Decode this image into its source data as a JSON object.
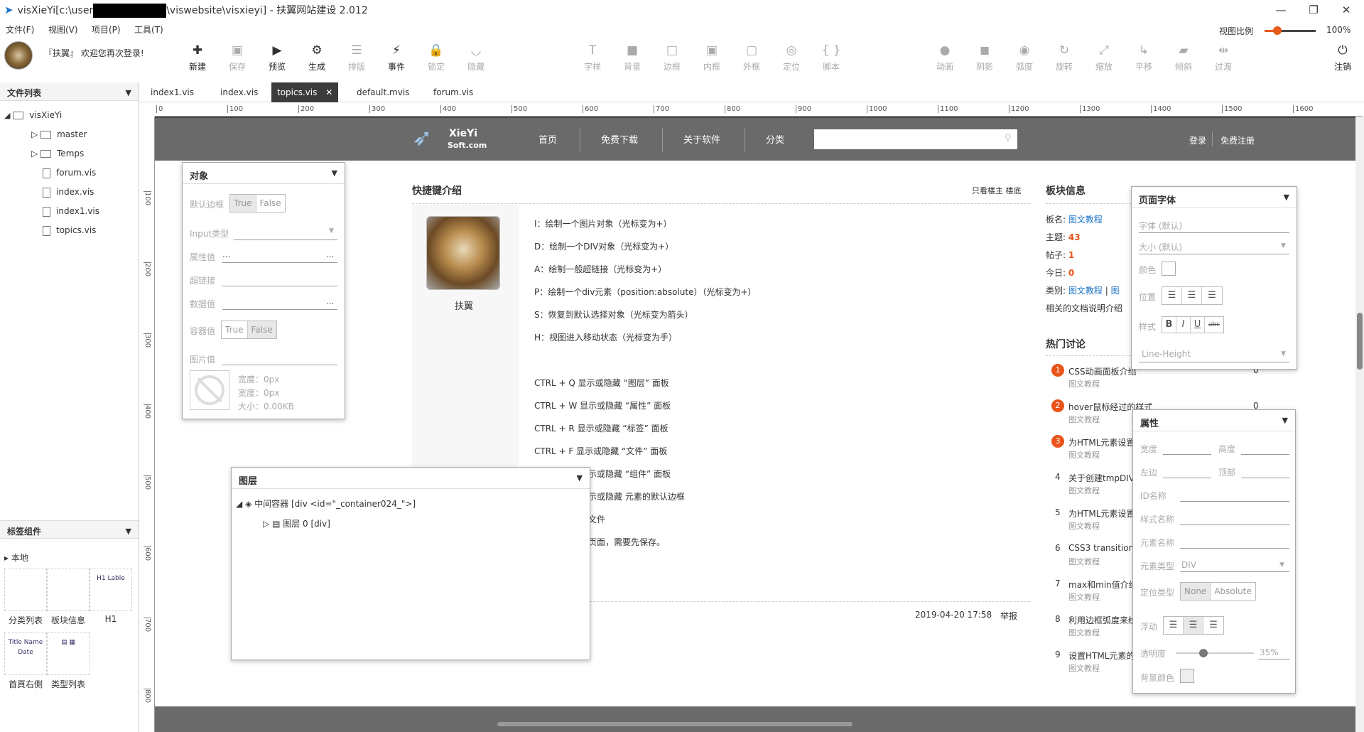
{
  "window": {
    "title_prefix": "visXieYi[c:\\user",
    "title_suffix": "\\viswebsite\\visxieyi] - 扶翼网站建设 2.012",
    "minimize": "—",
    "maximize": "❐",
    "close": "✕"
  },
  "menu": [
    "文件(F)",
    "视图(V)",
    "项目(P)",
    "工具(T)"
  ],
  "user": {
    "welcome": "『扶翼』 欢迎您再次登录!"
  },
  "toolbar": {
    "groups": [
      {
        "label": "新建",
        "glyph": "✚",
        "enabled": true
      },
      {
        "label": "保存",
        "glyph": "▣",
        "enabled": false
      },
      {
        "label": "预览",
        "glyph": "▶",
        "enabled": true
      },
      {
        "label": "生成",
        "glyph": "⚙",
        "enabled": true
      },
      {
        "label": "排版",
        "glyph": "☰",
        "enabled": false
      },
      {
        "label": "事件",
        "glyph": "⚡",
        "enabled": true
      },
      {
        "label": "锁定",
        "glyph": "🔒",
        "enabled": false
      },
      {
        "label": "隐藏",
        "glyph": "◡",
        "enabled": false
      },
      {
        "label": "字样",
        "glyph": "T",
        "enabled": false
      },
      {
        "label": "背景",
        "glyph": "■",
        "enabled": false
      },
      {
        "label": "边框",
        "glyph": "□",
        "enabled": false
      },
      {
        "label": "内框",
        "glyph": "▣",
        "enabled": false
      },
      {
        "label": "外框",
        "glyph": "▢",
        "enabled": false
      },
      {
        "label": "定位",
        "glyph": "◎",
        "enabled": false
      },
      {
        "label": "脚本",
        "glyph": "{ }",
        "enabled": false
      },
      {
        "label": "动画",
        "glyph": "●",
        "enabled": false
      },
      {
        "label": "阴影",
        "glyph": "◼",
        "enabled": false
      },
      {
        "label": "弧度",
        "glyph": "◉",
        "enabled": false
      },
      {
        "label": "旋转",
        "glyph": "↻",
        "enabled": false
      },
      {
        "label": "缩放",
        "glyph": "⤢",
        "enabled": false
      },
      {
        "label": "平移",
        "glyph": "↳",
        "enabled": false
      },
      {
        "label": "倾斜",
        "glyph": "▰",
        "enabled": false
      },
      {
        "label": "过渡",
        "glyph": "⇹",
        "enabled": false
      },
      {
        "label": "注销",
        "glyph": "⏻",
        "enabled": true
      }
    ]
  },
  "zoom": {
    "label": "视图比例",
    "value": "100%",
    "fraction": 0.25
  },
  "filelist": {
    "title": "文件列表",
    "root": "visXieYi",
    "folders": [
      "master",
      "Temps"
    ],
    "files": [
      "forum.vis",
      "index.vis",
      "index1.vis",
      "topics.vis"
    ]
  },
  "components": {
    "title": "标签组件",
    "group": "本地",
    "items": [
      {
        "label": "分类列表",
        "thumb": ""
      },
      {
        "label": "板块信息",
        "thumb": ""
      },
      {
        "label": "H1",
        "thumb": "H1 Lable"
      },
      {
        "label": "首頁右側",
        "thumb": "Title Name Date"
      },
      {
        "label": "类型列表",
        "thumb": "▤ ▦"
      }
    ]
  },
  "tabs": [
    {
      "label": "index1.vis",
      "active": false
    },
    {
      "label": "index.vis",
      "active": false
    },
    {
      "label": "topics.vis",
      "active": true,
      "close": "✕"
    },
    {
      "label": "default.mvis",
      "active": false
    },
    {
      "label": "forum.vis",
      "active": false
    }
  ],
  "ruler": {
    "h": [
      "0",
      "100",
      "200",
      "300",
      "400",
      "500",
      "600",
      "700",
      "800",
      "900",
      "1000",
      "1100",
      "1200",
      "1300",
      "1400",
      "1500",
      "1600"
    ],
    "v": [
      "100",
      "200",
      "300",
      "400",
      "500",
      "600",
      "700",
      "800"
    ]
  },
  "site": {
    "logo": {
      "line1": "XieYi",
      "line2": "Soft.com"
    },
    "nav": [
      "首页",
      "免费下载",
      "关于软件",
      "分类"
    ],
    "search_icon": "⚲",
    "login": "登录",
    "register": "免费注册",
    "article": {
      "title": "快捷键介绍",
      "only_author": "只看楼主",
      "floor": "楼底",
      "author": "扶翼",
      "date": "2019-04-20 17:58",
      "report": "举报",
      "lines": [
        "I：绘制一个图片对象（光标变为+）",
        "D：绘制一个DIV对象（光标变为+）",
        "A：绘制一般超链接（光标变为+）",
        "P：绘制一个div元素（position:absolute）（光标变为+）",
        "S：恢复到默认选择对象（光标变为箭头）",
        "H：视图进入移动状态（光标变为手）",
        "",
        "CTRL + Q 显示或隐藏 “图层” 面板",
        "CTRL + W 显示或隐藏 “属性” 面板",
        "CTRL + R 显示或隐藏 “标签” 面板",
        "CTRL + F 显示或隐藏 “文件” 面板",
        "示或隐藏 “组件” 面板",
        "示或隐藏 元素的默认边框",
        "文件",
        "页面，需要先保存。"
      ]
    },
    "block": {
      "title": "板块信息",
      "name_label": "板名:",
      "name": "图文教程",
      "topics_label": "主题:",
      "topics": "43",
      "posts_label": "帖子:",
      "posts": "1",
      "today_label": "今日:",
      "today": "0",
      "cat_label": "类别:",
      "cat": "图文教程",
      "cat2": "图",
      "desc": "相关的文档说明介绍"
    },
    "hot": {
      "title": "热门讨论",
      "items": [
        {
          "n": "1",
          "t": "CSS动画面板介绍",
          "c": "0",
          "sub": "图文教程"
        },
        {
          "n": "2",
          "t": "hover鼠标经过的样式",
          "c": "0",
          "sub": "图文教程"
        },
        {
          "n": "3",
          "t": "为HTML元素设置",
          "sub": "图文教程"
        },
        {
          "n": "4",
          "t": "关于创建tmpDIV",
          "sub": "图文教程"
        },
        {
          "n": "5",
          "t": "为HTML元素设置",
          "sub": "图文教程"
        },
        {
          "n": "6",
          "t": "CSS3 transition",
          "sub": "图文教程"
        },
        {
          "n": "7",
          "t": "max和min值介绍",
          "sub": "图文教程"
        },
        {
          "n": "8",
          "t": "利用边框弧度来绘",
          "sub": "图文教程"
        },
        {
          "n": "9",
          "t": "设置HTML元素的",
          "sub": "图文教程"
        }
      ]
    }
  },
  "panel_object": {
    "title": "对象",
    "border_label": "默认边框",
    "true": "True",
    "false": "False",
    "input_type": "Input类型",
    "attr_value": "属性值",
    "attr_ph": "...",
    "link": "超链接",
    "data_value": "数据值",
    "container": "容器值",
    "image": "图片值",
    "width1": "宽度：0px",
    "width2": "宽度：0px",
    "size": "大小：0.00KB"
  },
  "panel_layers": {
    "title": "图层",
    "root": "中间容器 [div  <id=\"_container024_\">]",
    "child": "图层 0 [div]"
  },
  "panel_font": {
    "title": "页面字体",
    "font": "字体 (默认)",
    "size": "大小 (默认)",
    "color": "颜色",
    "position": "位置",
    "style": "样式",
    "lineheight": "Line-Height",
    "styles": [
      "B",
      "I",
      "U",
      "abc"
    ]
  },
  "panel_props": {
    "title": "属性",
    "width": "宽度",
    "height": "高度",
    "left": "左边",
    "top": "顶部",
    "id": "ID名称",
    "style": "样式名称",
    "element": "元素名称",
    "eltype": "元素类型",
    "eltype_val": "DIV",
    "pos": "定位类型",
    "none": "None",
    "absolute": "Absolute",
    "float": "浮动",
    "opacity": "透明度",
    "opacity_val": "35%",
    "opacity_frac": 0.35,
    "bg": "背景颜色"
  },
  "colors": {
    "accent": "#e8541a",
    "link": "#1a73c7",
    "nav": "#6a6a6a"
  }
}
